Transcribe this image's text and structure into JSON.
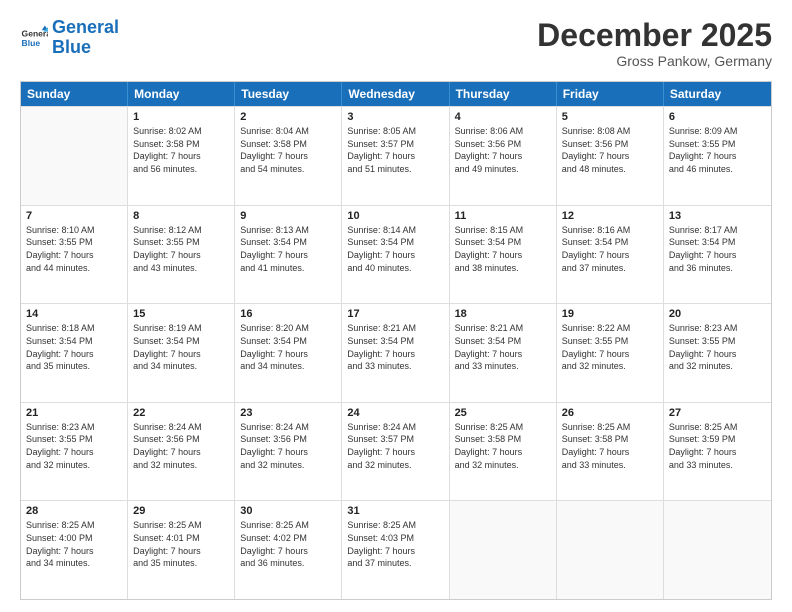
{
  "header": {
    "logo_general": "General",
    "logo_blue": "Blue",
    "title": "December 2025",
    "subtitle": "Gross Pankow, Germany"
  },
  "calendar": {
    "days": [
      "Sunday",
      "Monday",
      "Tuesday",
      "Wednesday",
      "Thursday",
      "Friday",
      "Saturday"
    ],
    "rows": [
      [
        {
          "day": "",
          "content": ""
        },
        {
          "day": "1",
          "content": "Sunrise: 8:02 AM\nSunset: 3:58 PM\nDaylight: 7 hours\nand 56 minutes."
        },
        {
          "day": "2",
          "content": "Sunrise: 8:04 AM\nSunset: 3:58 PM\nDaylight: 7 hours\nand 54 minutes."
        },
        {
          "day": "3",
          "content": "Sunrise: 8:05 AM\nSunset: 3:57 PM\nDaylight: 7 hours\nand 51 minutes."
        },
        {
          "day": "4",
          "content": "Sunrise: 8:06 AM\nSunset: 3:56 PM\nDaylight: 7 hours\nand 49 minutes."
        },
        {
          "day": "5",
          "content": "Sunrise: 8:08 AM\nSunset: 3:56 PM\nDaylight: 7 hours\nand 48 minutes."
        },
        {
          "day": "6",
          "content": "Sunrise: 8:09 AM\nSunset: 3:55 PM\nDaylight: 7 hours\nand 46 minutes."
        }
      ],
      [
        {
          "day": "7",
          "content": "Sunrise: 8:10 AM\nSunset: 3:55 PM\nDaylight: 7 hours\nand 44 minutes."
        },
        {
          "day": "8",
          "content": "Sunrise: 8:12 AM\nSunset: 3:55 PM\nDaylight: 7 hours\nand 43 minutes."
        },
        {
          "day": "9",
          "content": "Sunrise: 8:13 AM\nSunset: 3:54 PM\nDaylight: 7 hours\nand 41 minutes."
        },
        {
          "day": "10",
          "content": "Sunrise: 8:14 AM\nSunset: 3:54 PM\nDaylight: 7 hours\nand 40 minutes."
        },
        {
          "day": "11",
          "content": "Sunrise: 8:15 AM\nSunset: 3:54 PM\nDaylight: 7 hours\nand 38 minutes."
        },
        {
          "day": "12",
          "content": "Sunrise: 8:16 AM\nSunset: 3:54 PM\nDaylight: 7 hours\nand 37 minutes."
        },
        {
          "day": "13",
          "content": "Sunrise: 8:17 AM\nSunset: 3:54 PM\nDaylight: 7 hours\nand 36 minutes."
        }
      ],
      [
        {
          "day": "14",
          "content": "Sunrise: 8:18 AM\nSunset: 3:54 PM\nDaylight: 7 hours\nand 35 minutes."
        },
        {
          "day": "15",
          "content": "Sunrise: 8:19 AM\nSunset: 3:54 PM\nDaylight: 7 hours\nand 34 minutes."
        },
        {
          "day": "16",
          "content": "Sunrise: 8:20 AM\nSunset: 3:54 PM\nDaylight: 7 hours\nand 34 minutes."
        },
        {
          "day": "17",
          "content": "Sunrise: 8:21 AM\nSunset: 3:54 PM\nDaylight: 7 hours\nand 33 minutes."
        },
        {
          "day": "18",
          "content": "Sunrise: 8:21 AM\nSunset: 3:54 PM\nDaylight: 7 hours\nand 33 minutes."
        },
        {
          "day": "19",
          "content": "Sunrise: 8:22 AM\nSunset: 3:55 PM\nDaylight: 7 hours\nand 32 minutes."
        },
        {
          "day": "20",
          "content": "Sunrise: 8:23 AM\nSunset: 3:55 PM\nDaylight: 7 hours\nand 32 minutes."
        }
      ],
      [
        {
          "day": "21",
          "content": "Sunrise: 8:23 AM\nSunset: 3:55 PM\nDaylight: 7 hours\nand 32 minutes."
        },
        {
          "day": "22",
          "content": "Sunrise: 8:24 AM\nSunset: 3:56 PM\nDaylight: 7 hours\nand 32 minutes."
        },
        {
          "day": "23",
          "content": "Sunrise: 8:24 AM\nSunset: 3:56 PM\nDaylight: 7 hours\nand 32 minutes."
        },
        {
          "day": "24",
          "content": "Sunrise: 8:24 AM\nSunset: 3:57 PM\nDaylight: 7 hours\nand 32 minutes."
        },
        {
          "day": "25",
          "content": "Sunrise: 8:25 AM\nSunset: 3:58 PM\nDaylight: 7 hours\nand 32 minutes."
        },
        {
          "day": "26",
          "content": "Sunrise: 8:25 AM\nSunset: 3:58 PM\nDaylight: 7 hours\nand 33 minutes."
        },
        {
          "day": "27",
          "content": "Sunrise: 8:25 AM\nSunset: 3:59 PM\nDaylight: 7 hours\nand 33 minutes."
        }
      ],
      [
        {
          "day": "28",
          "content": "Sunrise: 8:25 AM\nSunset: 4:00 PM\nDaylight: 7 hours\nand 34 minutes."
        },
        {
          "day": "29",
          "content": "Sunrise: 8:25 AM\nSunset: 4:01 PM\nDaylight: 7 hours\nand 35 minutes."
        },
        {
          "day": "30",
          "content": "Sunrise: 8:25 AM\nSunset: 4:02 PM\nDaylight: 7 hours\nand 36 minutes."
        },
        {
          "day": "31",
          "content": "Sunrise: 8:25 AM\nSunset: 4:03 PM\nDaylight: 7 hours\nand 37 minutes."
        },
        {
          "day": "",
          "content": ""
        },
        {
          "day": "",
          "content": ""
        },
        {
          "day": "",
          "content": ""
        }
      ]
    ]
  }
}
